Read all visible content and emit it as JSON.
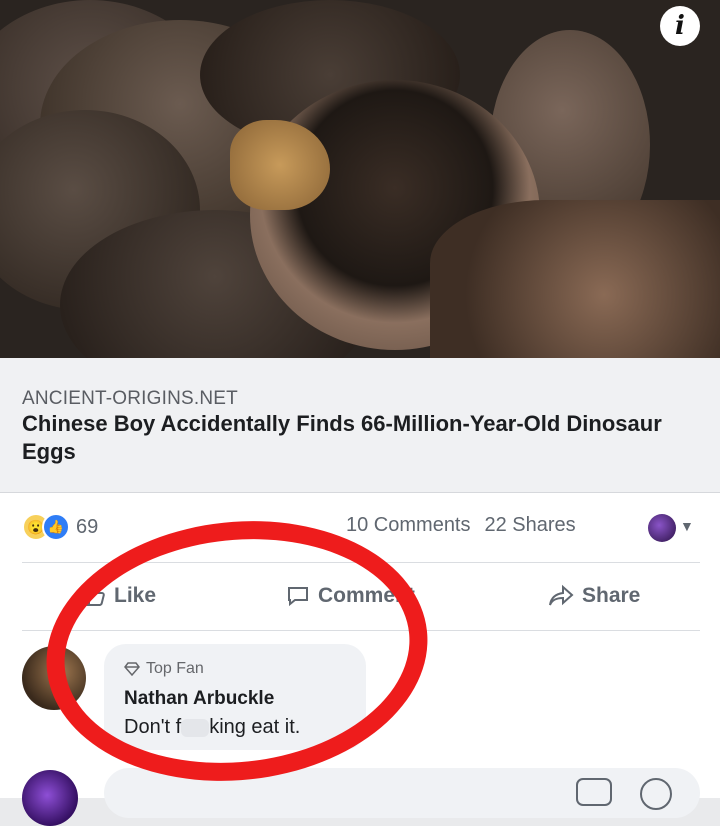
{
  "link_preview": {
    "domain": "ANCIENT-ORIGINS.NET",
    "headline": "Chinese Boy Accidentally Finds 66-Million-Year-Old Dinosaur Eggs",
    "info_glyph": "i"
  },
  "stats": {
    "reaction_count": "69",
    "comments": "10 Comments",
    "shares": "22 Shares",
    "reaction_icons": [
      "wow-icon",
      "like-icon"
    ]
  },
  "actions": {
    "like": "Like",
    "comment": "Comment",
    "share": "Share"
  },
  "comment": {
    "badge": "Top Fan",
    "author": "Nathan Arbuckle",
    "text_before": "Don't f",
    "text_after": "king eat it."
  },
  "colors": {
    "annotation_circle": "#ee1c1c",
    "accent_like": "#2f7df6"
  }
}
